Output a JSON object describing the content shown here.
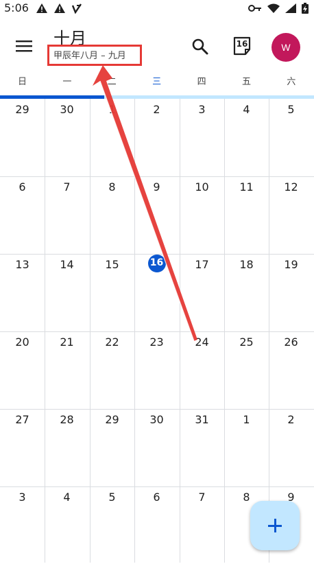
{
  "status_bar": {
    "time": "5:06",
    "left_icons": [
      "warning-icon",
      "warning-icon",
      "notification-v-icon"
    ],
    "right_icons": [
      "key-icon",
      "wifi-icon",
      "signal-icon",
      "battery-charging-icon"
    ]
  },
  "header": {
    "menu_icon": "menu-icon",
    "month_title": "十月",
    "lunar_range": "甲辰年八月 – 九月",
    "search_icon": "search-icon",
    "today_number": "16",
    "avatar_letter": "W",
    "avatar_color": "#c2185b"
  },
  "weekdays": [
    {
      "label": "日",
      "current": false
    },
    {
      "label": "一",
      "current": false
    },
    {
      "label": "二",
      "current": false
    },
    {
      "label": "三",
      "current": true
    },
    {
      "label": "四",
      "current": false
    },
    {
      "label": "五",
      "current": false
    },
    {
      "label": "六",
      "current": false
    }
  ],
  "weeks": [
    [
      "29",
      "30",
      "1",
      "2",
      "3",
      "4",
      "5"
    ],
    [
      "6",
      "7",
      "8",
      "9",
      "10",
      "11",
      "12"
    ],
    [
      "13",
      "14",
      "15",
      "16",
      "17",
      "18",
      "19"
    ],
    [
      "20",
      "21",
      "22",
      "23",
      "24",
      "25",
      "26"
    ],
    [
      "27",
      "28",
      "29",
      "30",
      "31",
      "1",
      "2"
    ],
    [
      "3",
      "4",
      "5",
      "6",
      "7",
      "8",
      "9"
    ]
  ],
  "today": {
    "week": 2,
    "day": 3,
    "color": "#0b57d0"
  },
  "fab": {
    "icon": "plus-icon",
    "color": "#c2e7ff"
  },
  "accent_color": "#0b57d0",
  "annotation": {
    "color": "#e53935"
  }
}
